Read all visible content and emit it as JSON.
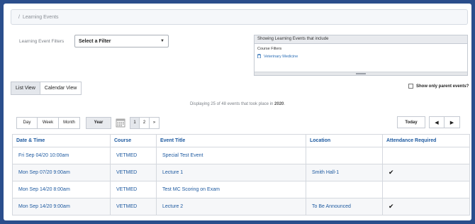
{
  "breadcrumb": {
    "separator": "/",
    "current": "Learning Events"
  },
  "filters": {
    "label": "Learning Event Filters",
    "select_value": "Select a Filter",
    "showing_header": "Showing Learning Events that include",
    "course_filters_label": "Course Filters",
    "course_filter_item": "Veterinary Medicine"
  },
  "view_toggle": {
    "list": "List View",
    "calendar": "Calendar View"
  },
  "parent_events_label": "Show only parent events?",
  "summary": {
    "prefix": "Displaying 25 of 48 events that took place in",
    "year": "2020",
    "suffix": "."
  },
  "range_buttons": [
    "Day",
    "Week",
    "Month"
  ],
  "year_button": "Year",
  "pagination": {
    "pages": [
      "1",
      "2"
    ],
    "next": "»"
  },
  "today_button": "Today",
  "nav": {
    "prev": "◀",
    "next": "▶"
  },
  "table": {
    "headers": [
      "Date & Time",
      "Course",
      "Event Title",
      "Location",
      "Attendance Required"
    ],
    "rows": [
      {
        "date": "Fri Sep 04/20 10:00am",
        "course": "VETMED",
        "title": "Special Test Event",
        "location": "",
        "attendance": ""
      },
      {
        "date": "Mon Sep 07/20 9:00am",
        "course": "VETMED",
        "title": "Lecture 1",
        "location": "Smith Hall-1",
        "attendance": "✔"
      },
      {
        "date": "Mon Sep 14/20 8:00am",
        "course": "VETMED",
        "title": "Test MC Scoring on Exam",
        "location": "",
        "attendance": ""
      },
      {
        "date": "Mon Sep 14/20 9:00am",
        "course": "VETMED",
        "title": "Lecture 2",
        "location": "To Be Announced",
        "attendance": "✔"
      }
    ]
  },
  "colors": {
    "frame": "#2b4e8c",
    "link": "#1e5aa0"
  }
}
